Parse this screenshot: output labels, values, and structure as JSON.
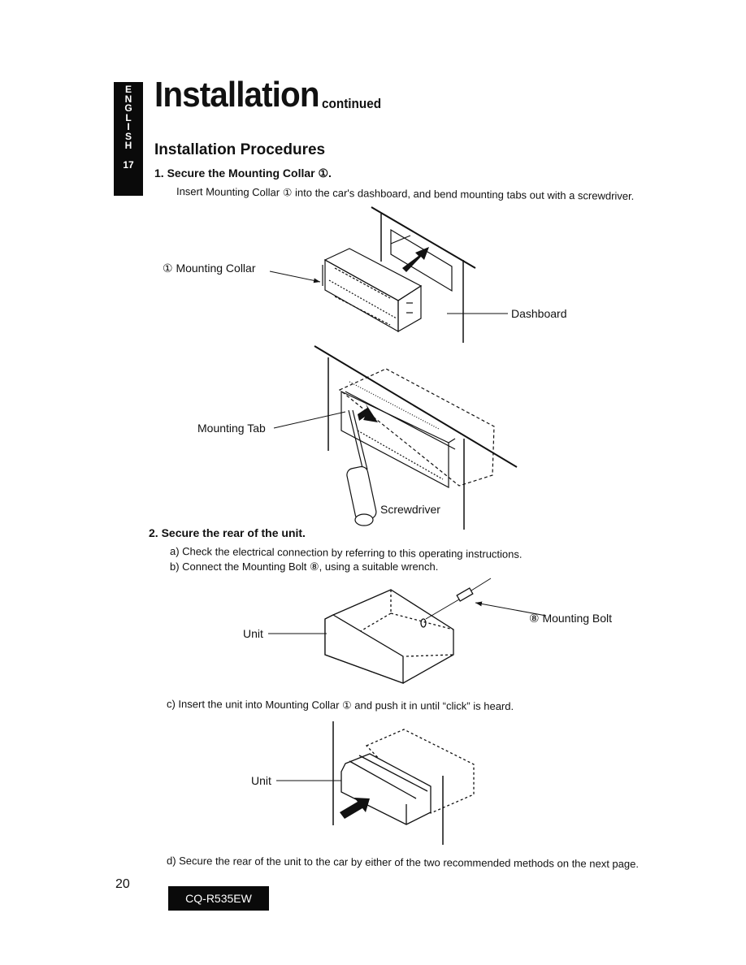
{
  "language_tab": {
    "letters": [
      "E",
      "N",
      "G",
      "L",
      "I",
      "S",
      "H"
    ],
    "section_number": "17"
  },
  "header": {
    "title": "Installation",
    "title_suffix": "continued"
  },
  "section": {
    "heading": "Installation Procedures",
    "step1": {
      "title": "1. Secure the Mounting Collar ①.",
      "body": "Insert Mounting Collar ① into the car's dashboard, and bend mounting tabs out with a screwdriver."
    },
    "figure1": {
      "labels": {
        "mounting_collar": "①  Mounting Collar",
        "dashboard": "Dashboard"
      }
    },
    "figure2": {
      "labels": {
        "mounting_tab": "Mounting Tab",
        "screwdriver": "Screwdriver"
      }
    },
    "step2": {
      "title": "2. Secure the rear of the unit.",
      "a": "a) Check the electrical connection by referring to this operating instructions.",
      "b": "b) Connect the Mounting Bolt ⑧, using a suitable wrench.",
      "c": "c) Insert the unit into Mounting Collar ① and push it in until “click” is heard.",
      "d": "d) Secure the rear of the unit to the car by either of the two recommended methods on the next page."
    },
    "figure3": {
      "labels": {
        "unit": "Unit",
        "mounting_bolt": "⑧  Mounting Bolt"
      }
    },
    "figure4": {
      "labels": {
        "unit": "Unit"
      }
    }
  },
  "footer": {
    "page_number": "20",
    "model": "CQ-R535EW"
  }
}
